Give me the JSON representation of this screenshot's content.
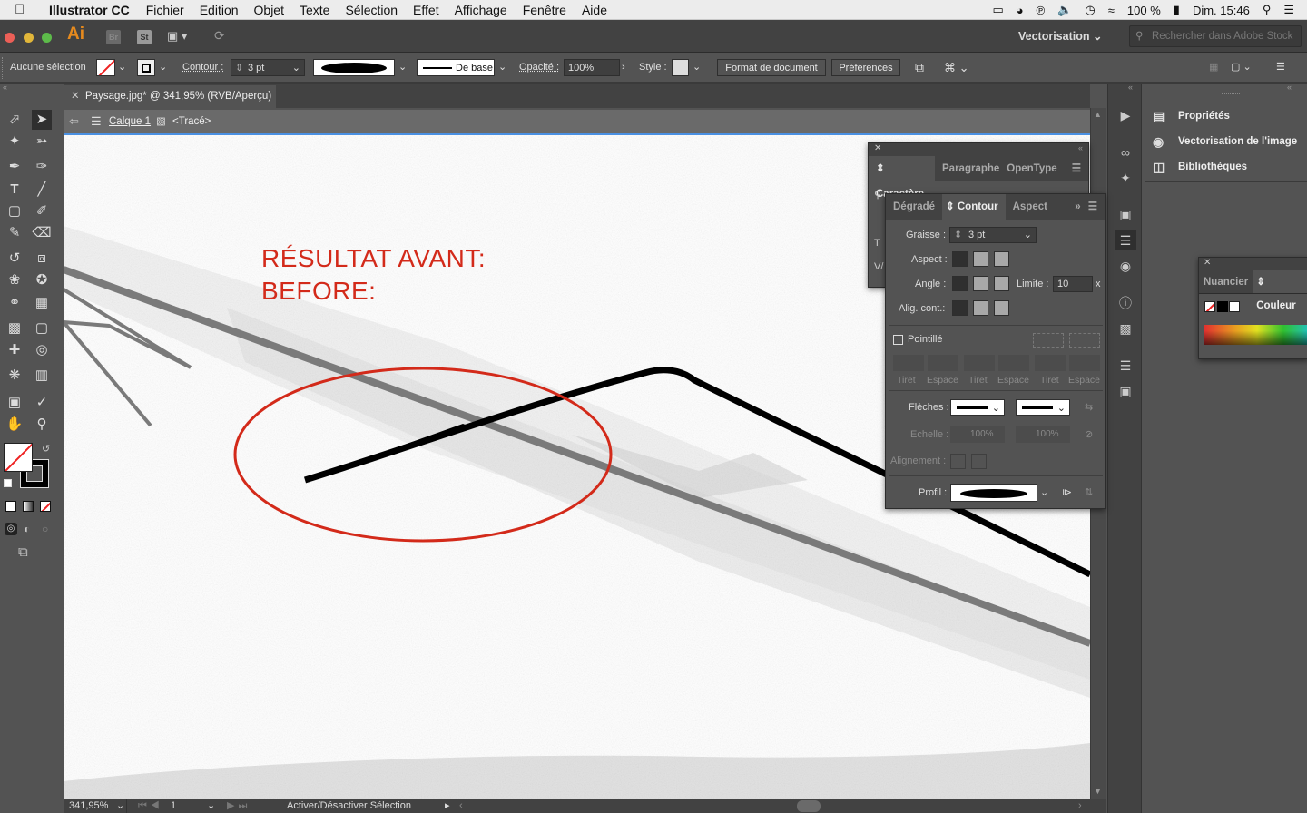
{
  "menubar": {
    "app": "Illustrator CC",
    "items": [
      "Fichier",
      "Edition",
      "Objet",
      "Texte",
      "Sélection",
      "Effet",
      "Affichage",
      "Fenêtre",
      "Aide"
    ],
    "battery": "100 %",
    "clock": "Dim. 15:46"
  },
  "appbar": {
    "logo": "Ai",
    "br": "Br",
    "st": "St",
    "workspace": "Vectorisation",
    "stock_placeholder": "Rechercher dans Adobe Stock"
  },
  "control": {
    "selection": "Aucune sélection",
    "stroke_label": "Contour :",
    "stroke_weight": "3 pt",
    "stroke_style": "De base",
    "opacity_label": "Opacité :",
    "opacity_value": "100%",
    "style_label": "Style :",
    "doc_setup": "Format de document",
    "preferences": "Préférences"
  },
  "document": {
    "tab_title": "Paysage.jpg* @ 341,95% (RVB/Aperçu)",
    "layer": "Calque 1",
    "object": "<Tracé>"
  },
  "canvas": {
    "annotation_line1": "RÉSULTAT AVANT:",
    "annotation_line2": "BEFORE:",
    "annotation_color": "#d32a1a"
  },
  "status": {
    "zoom": "341,95%",
    "page": "1",
    "message": "Activer/Désactiver Sélection"
  },
  "right_panel": {
    "items": [
      "Propriétés",
      "Vectorisation de l'image",
      "Bibliothèques"
    ]
  },
  "char_panel": {
    "tabs": [
      "Caractère",
      "Paragraphe",
      "OpenType"
    ]
  },
  "stroke_panel": {
    "tabs": [
      "Dégradé",
      "Contour",
      "Aspect"
    ],
    "weight_label": "Graisse :",
    "weight_value": "3 pt",
    "cap_label": "Aspect :",
    "corner_label": "Angle :",
    "limit_label": "Limite :",
    "limit_value": "10",
    "limit_unit": "x",
    "align_label": "Alig. cont.:",
    "dashed_label": "Pointillé",
    "dash_headers": [
      "Tiret",
      "Espace",
      "Tiret",
      "Espace",
      "Tiret",
      "Espace"
    ],
    "arrows_label": "Flèches :",
    "scale_label": "Echelle :",
    "scale_values": [
      "100%",
      "100%"
    ],
    "alignment_label": "Alignement :",
    "profile_label": "Profil :"
  },
  "swatch_panel": {
    "tabs": [
      "Nuancier",
      "Couleur"
    ]
  }
}
